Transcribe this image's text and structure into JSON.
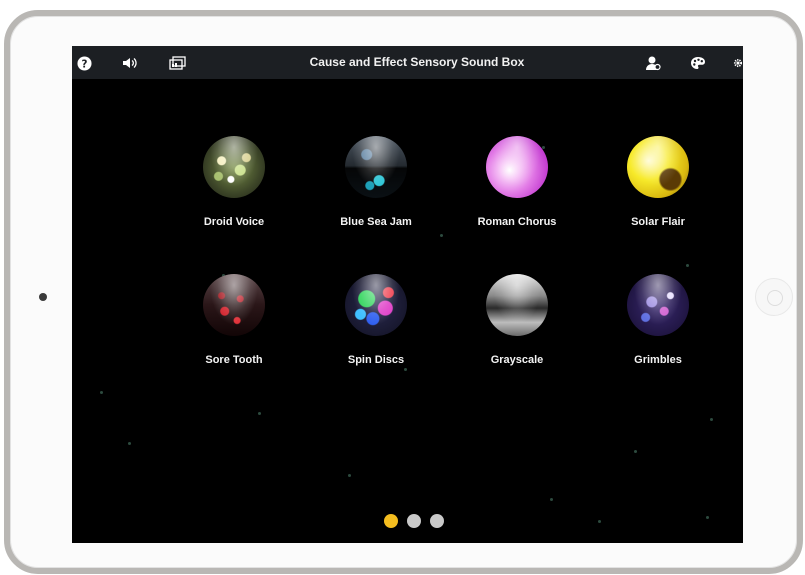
{
  "app": {
    "title": "Cause and Effect Sensory Sound Box"
  },
  "toolbar": {
    "left_icons": [
      "help-icon",
      "volume-icon",
      "gallery-icon"
    ],
    "right_icons": [
      "user-settings-icon",
      "palette-icon",
      "settings-icon"
    ]
  },
  "sounds": [
    {
      "label": "Droid Voice",
      "style": "droid"
    },
    {
      "label": "Blue Sea Jam",
      "style": "bluesea"
    },
    {
      "label": "Roman Chorus",
      "style": "roman"
    },
    {
      "label": "Solar Flair",
      "style": "solar"
    },
    {
      "label": "Sore Tooth",
      "style": "sore"
    },
    {
      "label": "Spin Discs",
      "style": "spin"
    },
    {
      "label": "Grayscale",
      "style": "gray"
    },
    {
      "label": "Grimbles",
      "style": "grimbles"
    }
  ],
  "pager": {
    "page_count": 3,
    "current_page": 1,
    "active_color": "#f4bd1f",
    "inactive_color": "#c9c9c9"
  }
}
